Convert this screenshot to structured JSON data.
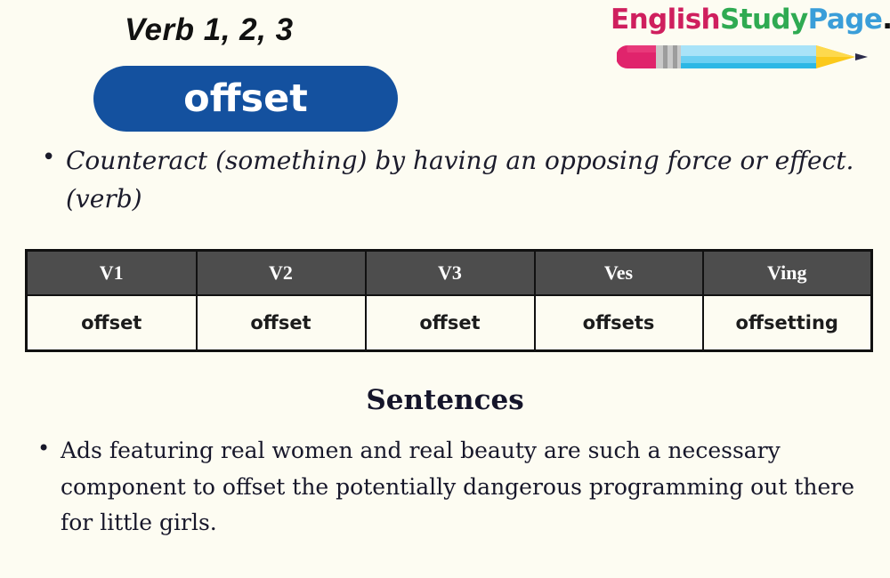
{
  "page": {
    "background_color": "#fdfcf2",
    "title": "Verb 1, 2, 3",
    "word": "offset",
    "word_pill_color": "#14519f",
    "word_text_color": "#ffffff"
  },
  "logo": {
    "segments": [
      {
        "text": "English",
        "color": "#cf1f5e",
        "name": "logo-segment-english"
      },
      {
        "text": "Study",
        "color": "#2faa52",
        "name": "logo-segment-study"
      },
      {
        "text": "Page",
        "color": "#3a9ed9",
        "name": "logo-segment-page"
      },
      {
        "text": ".Com",
        "color": "#111111",
        "name": "logo-segment-com"
      }
    ],
    "full_text": "EnglishStudyPage.Com",
    "icon": "pencil-icon",
    "pencil_colors": {
      "eraser": "#e0246c",
      "ferrule": "#bdbdbd",
      "body": "#62cdf0",
      "body_shade": "#2eb8e6",
      "wood": "#fbc91b",
      "tip": "#2b2b4a"
    }
  },
  "definition": {
    "items": [
      "Counteract (something) by having an opposing force or effect.(verb)"
    ]
  },
  "table": {
    "header_background": "#4d4d4d",
    "header_text_color": "#ffffff",
    "columns": [
      "V1",
      "V2",
      "V3",
      "Ves",
      "Ving"
    ],
    "rows": [
      [
        "offset",
        "offset",
        "offset",
        "offsets",
        "offsetting"
      ]
    ]
  },
  "sentences": {
    "heading": "Sentences",
    "items": [
      "Ads featuring real women and real beauty are such a necessary component to offset the potentially dangerous programming out there for little girls."
    ]
  }
}
